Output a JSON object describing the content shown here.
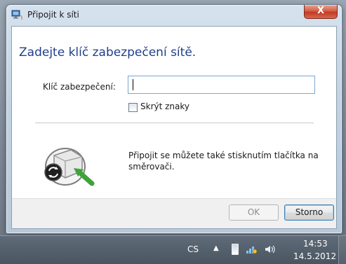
{
  "window": {
    "title": "Připojit k síti",
    "close_label": "X"
  },
  "dialog": {
    "heading": "Zadejte klíč zabezpečení sítě.",
    "key_label": "Klíč zabezpečení:",
    "key_value": "",
    "hide_chars_label": "Skrýt znaky",
    "hide_chars_checked": false,
    "info_text": "Připojit se můžete také stisknutím tlačítka na směrovači.",
    "router_icon": "router-wps-icon",
    "buttons": {
      "ok": "OK",
      "ok_enabled": false,
      "cancel": "Storno"
    }
  },
  "taskbar": {
    "language": "CS",
    "time": "14:53",
    "date": "14.5.2012",
    "tray_icons": [
      "show-hidden-icons-arrow",
      "battery-icon",
      "network-icon",
      "volume-icon"
    ]
  }
}
